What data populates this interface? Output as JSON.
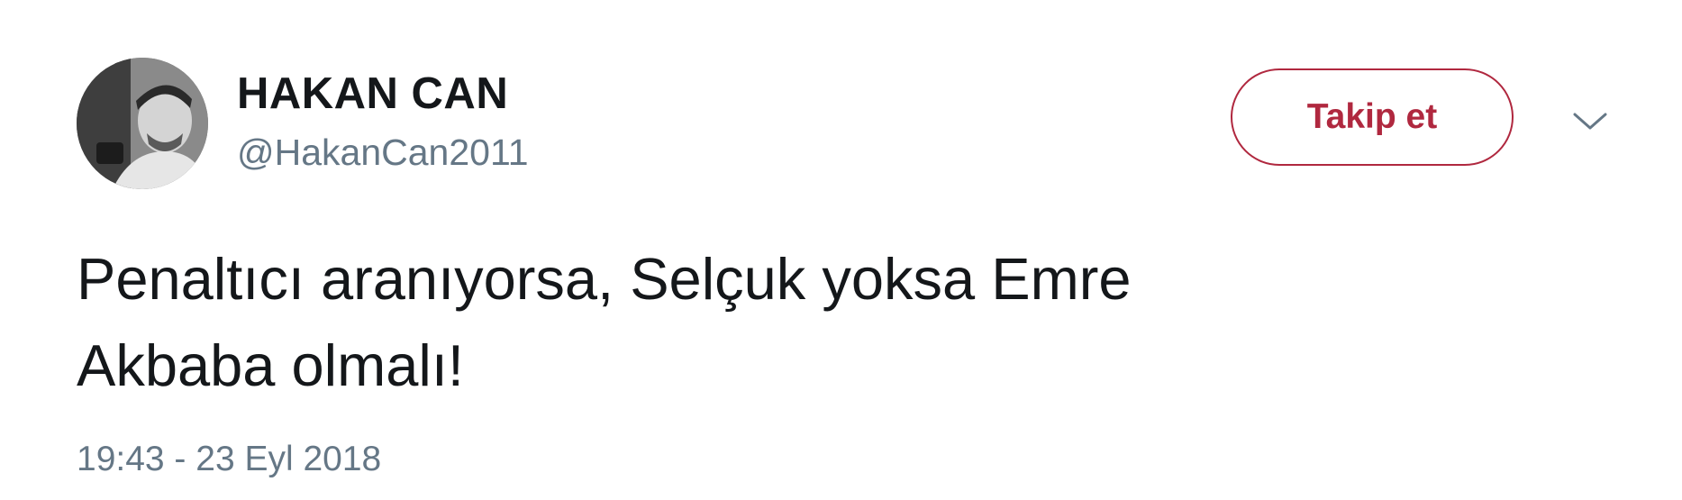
{
  "author": {
    "display_name": "HAKAN CAN",
    "handle": "@HakanCan2011",
    "avatar_icon": "profile-photo"
  },
  "actions": {
    "follow_label": "Takip et",
    "menu_icon": "chevron-down-icon"
  },
  "tweet": {
    "lines": [
      "Penaltıcı aranıyorsa, Selçuk yoksa Emre",
      "Akbaba olmalı!"
    ],
    "timestamp": "19:43 - 23 Eyl 2018"
  },
  "colors": {
    "accent": "#b0283f",
    "text": "#14171a",
    "secondary": "#657786",
    "background": "#ffffff"
  }
}
